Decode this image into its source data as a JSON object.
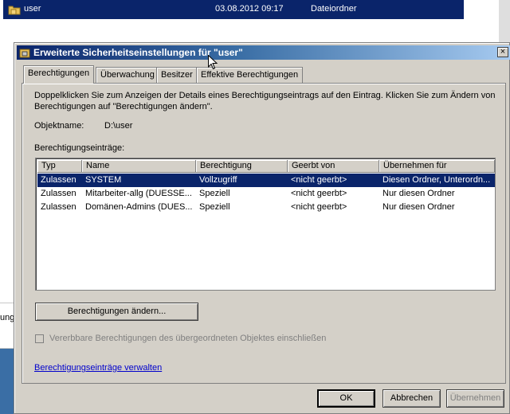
{
  "explorer": {
    "row_name": "user",
    "row_date": "03.08.2012 09:17",
    "row_type": "Dateiordner",
    "left_fragment": "ungs"
  },
  "dialog": {
    "title": "Erweiterte Sicherheitseinstellungen für \"user\"",
    "close_label": "×",
    "tabs": [
      {
        "label": "Berechtigungen"
      },
      {
        "label": "Überwachung"
      },
      {
        "label": "Besitzer"
      },
      {
        "label": "Effektive Berechtigungen"
      }
    ],
    "description": "Doppelklicken Sie zum Anzeigen der Details eines Berechtigungseintrags auf den Eintrag. Klicken Sie zum Ändern von Berechtigungen auf \"Berechtigungen ändern\".",
    "object_name_label": "Objektname:",
    "object_name_value": "D:\\user",
    "entries_label": "Berechtigungseinträge:",
    "columns": [
      "Typ",
      "Name",
      "Berechtigung",
      "Geerbt von",
      "Übernehmen für"
    ],
    "rows": [
      {
        "typ": "Zulassen",
        "name": "SYSTEM",
        "berechtigung": "Vollzugriff",
        "geerbt": "<nicht geerbt>",
        "uebernehmen": "Diesen Ordner, Unterordn..."
      },
      {
        "typ": "Zulassen",
        "name": "Mitarbeiter-allg (DUESSE...",
        "berechtigung": "Speziell",
        "geerbt": "<nicht geerbt>",
        "uebernehmen": "Nur diesen Ordner"
      },
      {
        "typ": "Zulassen",
        "name": "Domänen-Admins (DUES...",
        "berechtigung": "Speziell",
        "geerbt": "<nicht geerbt>",
        "uebernehmen": "Nur diesen Ordner"
      }
    ],
    "change_button": "Berechtigungen ändern...",
    "inherit_checkbox_label": "Vererbbare Berechtigungen des übergeordneten Objektes einschließen",
    "manage_link": "Berechtigungseinträge verwalten",
    "ok_button": "OK",
    "cancel_button": "Abbrechen",
    "apply_button": "Übernehmen"
  },
  "colors": {
    "selection": "#0a246a",
    "dialog_face": "#d4d0c8",
    "link": "#0000cc"
  }
}
